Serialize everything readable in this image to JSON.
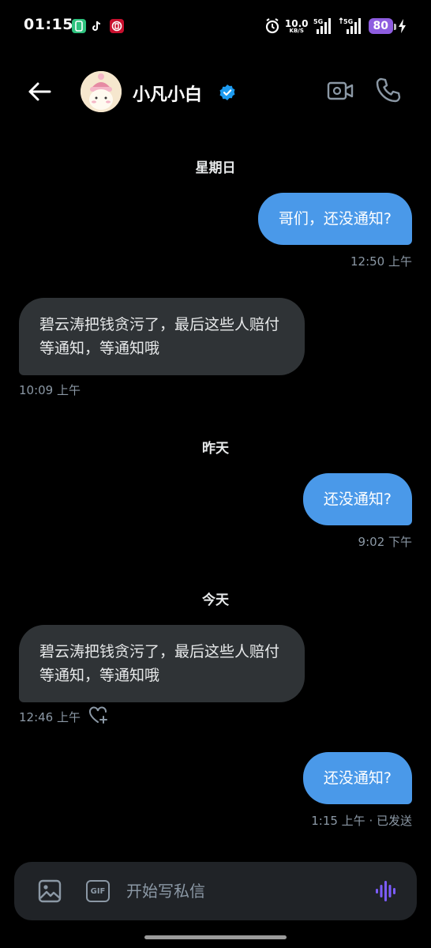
{
  "status_bar": {
    "time": "01:15",
    "net_speed": "10.0",
    "net_speed_unit": "KB/S",
    "signal1_label": "5G",
    "signal2_label": "5G",
    "battery": "80",
    "app_icons": [
      "wallet-app-icon",
      "tiktok-app-icon",
      "bank-app-icon"
    ]
  },
  "header": {
    "contact_name": "小凡小白",
    "verified": true,
    "accent": "#1d9bf0"
  },
  "conversation": {
    "day1": "星期日",
    "msg1": {
      "text": "哥们，还没通知?",
      "time": "12:50 上午"
    },
    "msg2": {
      "text": "碧云涛把钱贪污了，最后这些人赔付等通知，等通知哦",
      "time": "10:09 上午"
    },
    "day2": "昨天",
    "msg3": {
      "text": "还没通知?",
      "time": "9:02 下午"
    },
    "day3": "今天",
    "msg4": {
      "text": "碧云涛把钱贪污了，最后这些人赔付等通知，等通知哦",
      "time": "12:46 上午"
    },
    "msg5": {
      "text": "还没通知?",
      "time": "1:15 上午 · 已发送"
    }
  },
  "composer": {
    "gif_label": "GIF",
    "placeholder": "开始写私信",
    "value": ""
  },
  "colors": {
    "outgoing_bubble": "#4a99e9",
    "incoming_bubble": "#2f3336",
    "voice_accent": "#7c5cff"
  }
}
